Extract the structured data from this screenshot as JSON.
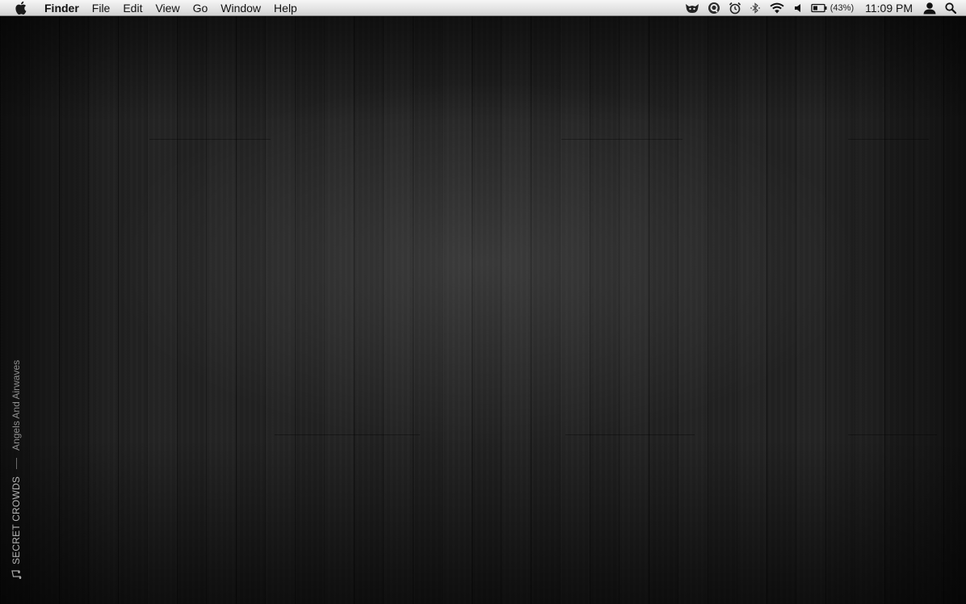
{
  "menubar": {
    "apple_icon": "apple-logo-icon",
    "app_name": "Finder",
    "menus": [
      "File",
      "Edit",
      "View",
      "Go",
      "Window",
      "Help"
    ],
    "status_icons": [
      "cat-icon",
      "quicksilver-icon",
      "alarm-clock-icon",
      "bluetooth-icon",
      "wifi-icon",
      "volume-icon",
      "battery-icon"
    ],
    "battery_percent": "(43%)",
    "clock": "11:09 PM",
    "user_icon": "user-icon",
    "spotlight_icon": "search-icon"
  },
  "now_playing": {
    "icon": "music-note-icon",
    "artist": "SECRET CROWDS",
    "track": "Angels And Airwaves"
  }
}
